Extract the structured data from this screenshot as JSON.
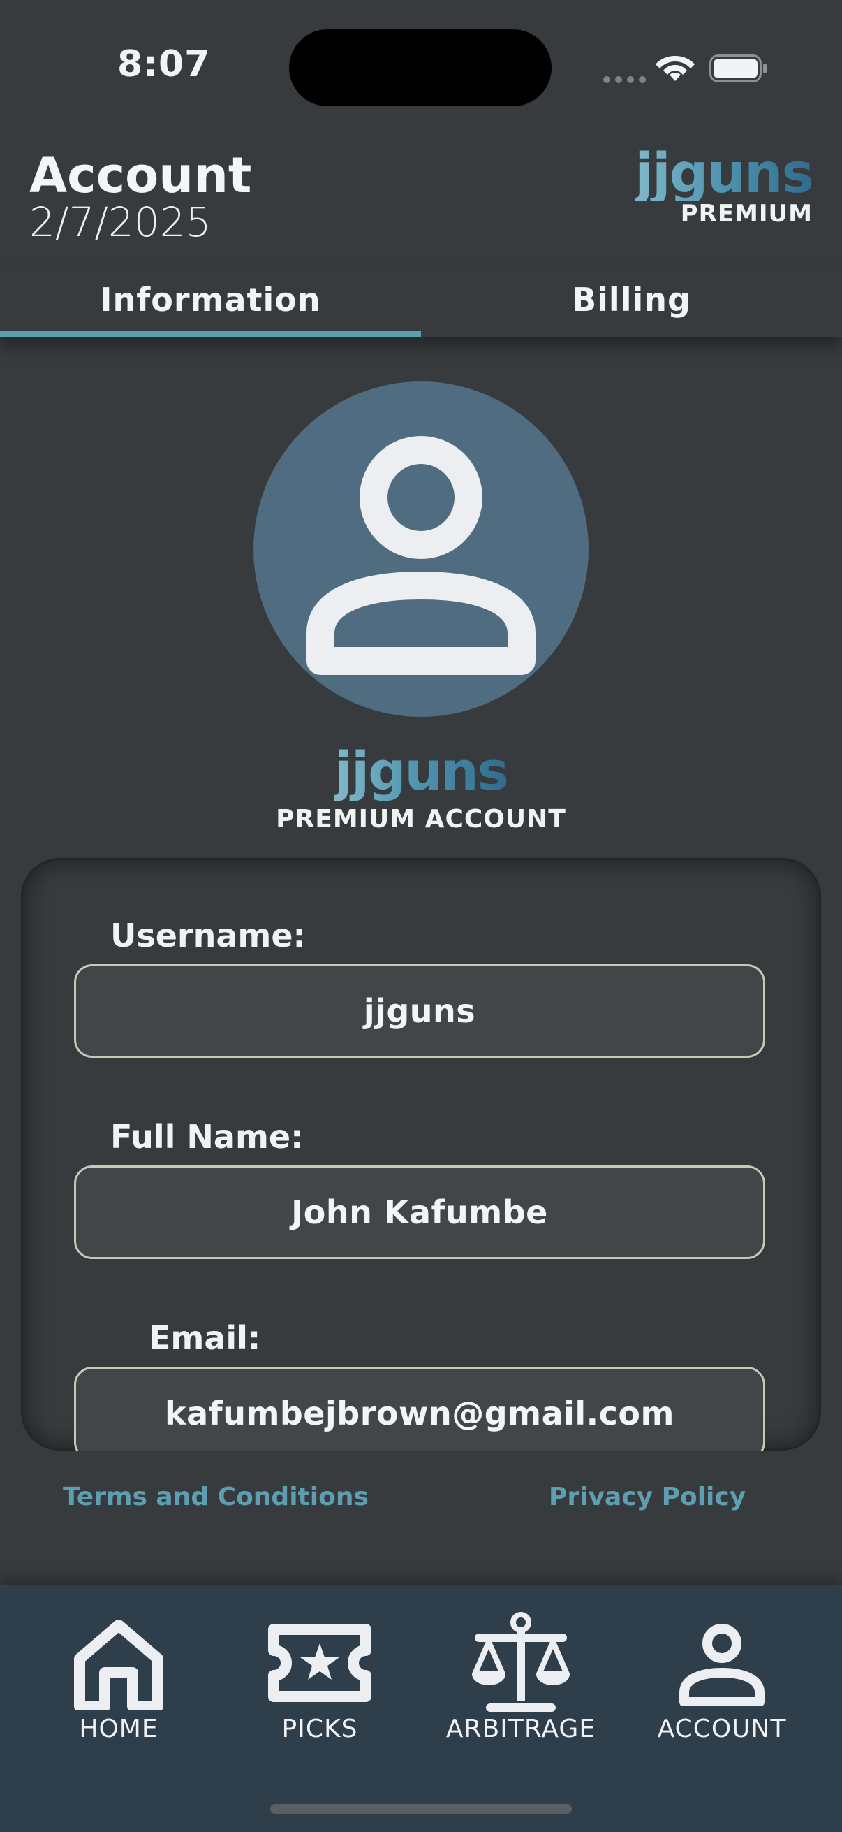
{
  "status_bar": {
    "time": "8:07"
  },
  "header": {
    "title": "Account",
    "date": "2/7/2025",
    "brand_name": "jjguns",
    "brand_tier": "PREMIUM"
  },
  "tabs": [
    {
      "label": "Information",
      "active": true
    },
    {
      "label": "Billing",
      "active": false
    }
  ],
  "profile": {
    "username_display": "jjguns",
    "account_tier": "PREMIUM ACCOUNT"
  },
  "fields": {
    "username": {
      "label": "Username:",
      "value": "jjguns"
    },
    "full_name": {
      "label": "Full Name:",
      "value": "John Kafumbe"
    },
    "email": {
      "label": "Email:",
      "value": "kafumbejbrown@gmail.com"
    }
  },
  "links": {
    "terms": "Terms and Conditions",
    "privacy": "Privacy Policy"
  },
  "nav": [
    {
      "label": "HOME",
      "icon": "home-icon"
    },
    {
      "label": "PICKS",
      "icon": "ticket-star-icon"
    },
    {
      "label": "ARBITRAGE",
      "icon": "scale-icon"
    },
    {
      "label": "ACCOUNT",
      "icon": "user-icon"
    }
  ],
  "colors": {
    "background": "#373b3e",
    "accent": "#5e9eae",
    "avatar_bg": "#506c80",
    "nav_bg": "#2e3e4a",
    "link": "#5d9fb1"
  }
}
